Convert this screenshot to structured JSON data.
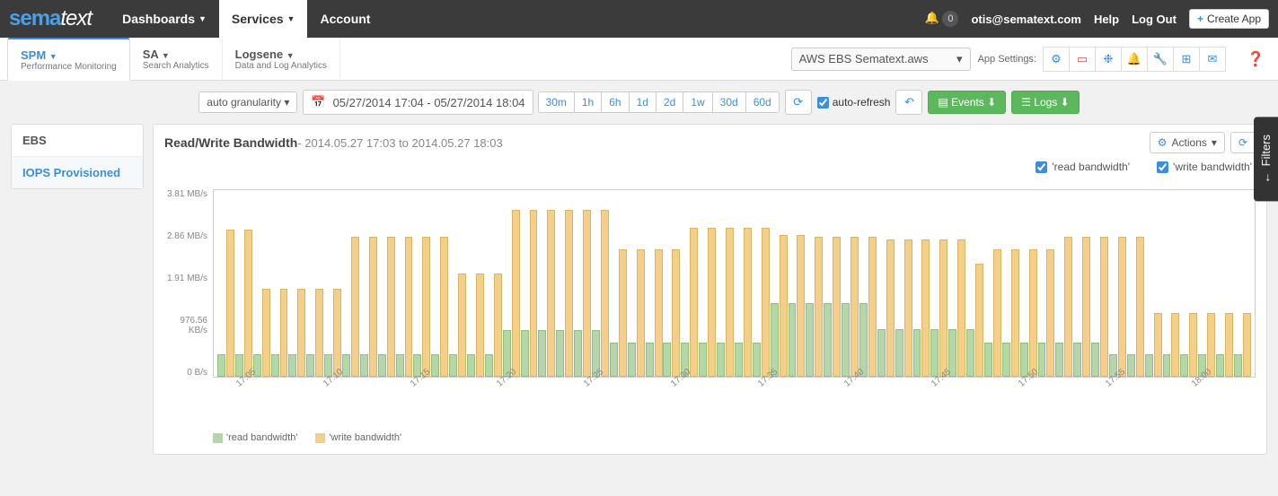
{
  "nav": {
    "logo_prefix": "sema",
    "logo_suffix": "text",
    "items": [
      "Dashboards",
      "Services",
      "Account"
    ],
    "active": "Services",
    "badge": "0",
    "user": "otis@sematext.com",
    "help": "Help",
    "logout": "Log Out",
    "create": "Create App"
  },
  "subnav": {
    "tabs": [
      {
        "title": "SPM",
        "sub": "Performance Monitoring"
      },
      {
        "title": "SA",
        "sub": "Search Analytics"
      },
      {
        "title": "Logsene",
        "sub": "Data and Log Analytics"
      }
    ],
    "app_selected": "AWS EBS Sematext.aws",
    "settings_label": "App Settings:"
  },
  "toolbar": {
    "granularity": "auto granularity",
    "daterange": "05/27/2014 17:04 - 05/27/2014 18:04",
    "ranges": [
      "30m",
      "1h",
      "6h",
      "1d",
      "2d",
      "1w",
      "30d",
      "60d"
    ],
    "autorefresh": "auto-refresh",
    "events": "Events",
    "logs": "Logs"
  },
  "left": {
    "items": [
      "EBS",
      "IOPS Provisioned"
    ],
    "active": "IOPS Provisioned"
  },
  "chart": {
    "title": "Read/Write Bandwidth",
    "sub": " - 2014.05.27 17:03 to 2014.05.27 18:03",
    "actions": "Actions",
    "series_labels": [
      "'read bandwidth'",
      "'write bandwidth'"
    ]
  },
  "filters": "Filters",
  "chart_data": {
    "type": "bar",
    "ylabel_ticks": [
      "3.81 MB/s",
      "2.86 MB/s",
      "1.91 MB/s",
      "976.56 KB/s",
      "0 B/s"
    ],
    "ylim_mb": [
      0,
      3.81
    ],
    "x_ticks": [
      "17:05",
      "17:10",
      "17:15",
      "17:20",
      "17:25",
      "17:30",
      "17:35",
      "17:40",
      "17:45",
      "17:50",
      "17:55",
      "18:00"
    ],
    "series": [
      {
        "name": "'read bandwidth'",
        "color": "#b5d6a9",
        "values_mb": [
          0.45,
          0.45,
          0.45,
          0.45,
          0.45,
          0.45,
          0.45,
          0.45,
          0.45,
          0.45,
          0.45,
          0.45,
          0.45,
          0.45,
          0.45,
          0.45,
          0.95,
          0.95,
          0.95,
          0.95,
          0.95,
          0.95,
          0.7,
          0.7,
          0.7,
          0.7,
          0.7,
          0.7,
          0.7,
          0.7,
          0.7,
          1.5,
          1.5,
          1.5,
          1.5,
          1.5,
          1.5,
          0.98,
          0.98,
          0.98,
          0.98,
          0.98,
          0.98,
          0.7,
          0.7,
          0.7,
          0.7,
          0.7,
          0.7,
          0.7,
          0.45,
          0.45,
          0.45,
          0.45,
          0.45,
          0.45,
          0.45,
          0.45
        ]
      },
      {
        "name": "'write bandwidth'",
        "color": "#f3cf8a",
        "values_mb": [
          3.0,
          3.0,
          1.8,
          1.8,
          1.8,
          1.8,
          1.8,
          2.86,
          2.86,
          2.86,
          2.86,
          2.86,
          2.86,
          2.1,
          2.1,
          2.1,
          3.4,
          3.4,
          3.4,
          3.4,
          3.4,
          3.4,
          2.6,
          2.6,
          2.6,
          2.6,
          3.05,
          3.05,
          3.05,
          3.05,
          3.05,
          2.9,
          2.9,
          2.86,
          2.86,
          2.86,
          2.86,
          2.8,
          2.8,
          2.8,
          2.8,
          2.8,
          2.3,
          2.6,
          2.6,
          2.6,
          2.6,
          2.86,
          2.86,
          2.86,
          2.86,
          2.86,
          1.3,
          1.3,
          1.3,
          1.3,
          1.3,
          1.3
        ]
      }
    ]
  }
}
